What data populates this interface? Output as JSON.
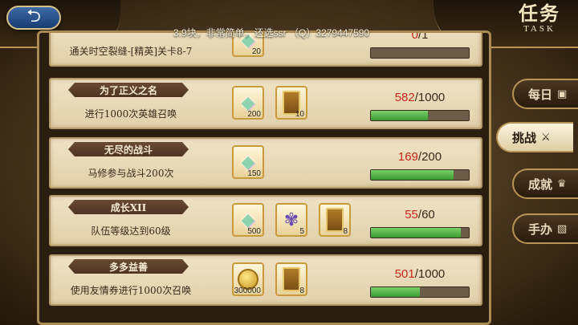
{
  "header": {
    "back_icon": "back-arrow-icon",
    "back_glyph": "⮌",
    "title": "任务",
    "title_en": "TASK"
  },
  "watermark": "3.9块，非常简单，还选ssr （Q）3279447590",
  "tasks": [
    {
      "name": "",
      "desc": "通关时空裂缝-[精英]关卡8-7",
      "rewards": [
        {
          "icon": "gem-icon",
          "glyph": "◆",
          "qty": "20"
        }
      ],
      "current": "0",
      "total": "/1",
      "progress": 0.0
    },
    {
      "name": "为了正义之名",
      "desc": "进行1000次英雄召唤",
      "rewards": [
        {
          "icon": "gem-icon",
          "glyph": "◆",
          "qty": "200"
        },
        {
          "icon": "summon-ticket-icon",
          "glyph": "",
          "qty": "10"
        }
      ],
      "current": "582",
      "total": "/1000",
      "progress": 0.582
    },
    {
      "name": "无尽的战斗",
      "desc": "马修参与战斗200次",
      "rewards": [
        {
          "icon": "gem-icon",
          "glyph": "◆",
          "qty": "150"
        }
      ],
      "current": "169",
      "total": "/200",
      "progress": 0.845
    },
    {
      "name": "成长XII",
      "desc": "队伍等级达到60级",
      "rewards": [
        {
          "icon": "gem-icon",
          "glyph": "◆",
          "qty": "500"
        },
        {
          "icon": "creature-icon",
          "glyph": "✾",
          "qty": "5"
        },
        {
          "icon": "summon-ticket-icon",
          "glyph": "",
          "qty": "8"
        }
      ],
      "current": "55",
      "total": "/60",
      "progress": 0.917
    },
    {
      "name": "多多益善",
      "desc": "使用友情券进行1000次召唤",
      "rewards": [
        {
          "icon": "gold-coin-icon",
          "glyph": "",
          "qty": "300000"
        },
        {
          "icon": "summon-ticket-icon",
          "glyph": "",
          "qty": "8"
        }
      ],
      "current": "501",
      "total": "/1000",
      "progress": 0.501
    }
  ],
  "tabs": [
    {
      "label": "每日",
      "icon": "calendar-icon",
      "glyph": "▣",
      "active": false
    },
    {
      "label": "挑战",
      "icon": "crossed-swords-icon",
      "glyph": "⚔",
      "active": true
    },
    {
      "label": "成就",
      "icon": "trophy-icon",
      "glyph": "♛",
      "active": false
    },
    {
      "label": "手办",
      "icon": "figure-icon",
      "glyph": "▧",
      "active": false
    }
  ]
}
